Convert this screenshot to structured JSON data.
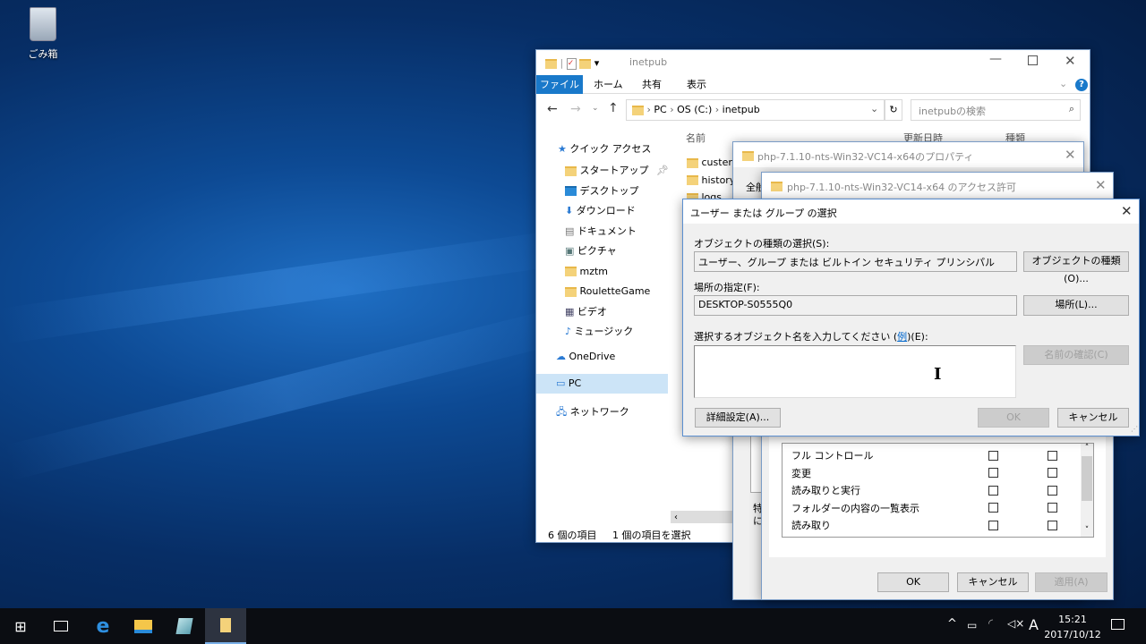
{
  "desktop": {
    "recycle_bin_label": "ごみ箱"
  },
  "explorer": {
    "title": "inetpub",
    "ribbon_tabs": [
      "ファイル",
      "ホーム",
      "共有",
      "表示"
    ],
    "breadcrumb": [
      "PC",
      "OS (C:)",
      "inetpub"
    ],
    "search_placeholder": "inetpubの検索",
    "columns": [
      "名前",
      "更新日時",
      "種類"
    ],
    "files": [
      "custerr",
      "history",
      "logs"
    ],
    "nav": {
      "quick_access": "クイック アクセス",
      "items": [
        "スタートアップ",
        "デスクトップ",
        "ダウンロード",
        "ドキュメント",
        "ピクチャ",
        "mztm",
        "RouletteGame",
        "ビデオ",
        "ミュージック"
      ],
      "onedrive": "OneDrive",
      "pc": "PC",
      "network": "ネットワーク"
    },
    "status": {
      "count": "6 個の項目",
      "selected": "1 個の項目を選択"
    }
  },
  "properties": {
    "title": "php-7.1.10-nts-Win32-VC14-x64のプロパティ",
    "tab": "全般",
    "note1": "特",
    "note2": "に"
  },
  "permissions": {
    "title": "php-7.1.10-nts-Win32-VC14-x64 のアクセス許可",
    "rows": [
      "フル コントロール",
      "変更",
      "読み取りと実行",
      "フォルダーの内容の一覧表示",
      "読み取り"
    ],
    "ok": "OK",
    "cancel": "キャンセル",
    "apply": "適用(A)"
  },
  "select_dialog": {
    "title": "ユーザー または グループ の選択",
    "object_type_label": "オブジェクトの種類の選択(S):",
    "object_type_value": "ユーザー、グループ または ビルトイン セキュリティ プリンシパル",
    "object_type_button": "オブジェクトの種類(O)...",
    "location_label": "場所の指定(F):",
    "location_value": "DESKTOP-S0555Q0",
    "location_button": "場所(L)...",
    "name_label": "選択するオブジェクト名を入力してください (",
    "example_link": "例",
    "name_label_suffix": ")(E):",
    "name_value": "",
    "check_names_button": "名前の確認(C)",
    "advanced_button": "詳細設定(A)...",
    "ok": "OK",
    "cancel": "キャンセル"
  },
  "taskbar": {
    "time": "15:21",
    "date": "2017/10/12",
    "ime": "A"
  }
}
